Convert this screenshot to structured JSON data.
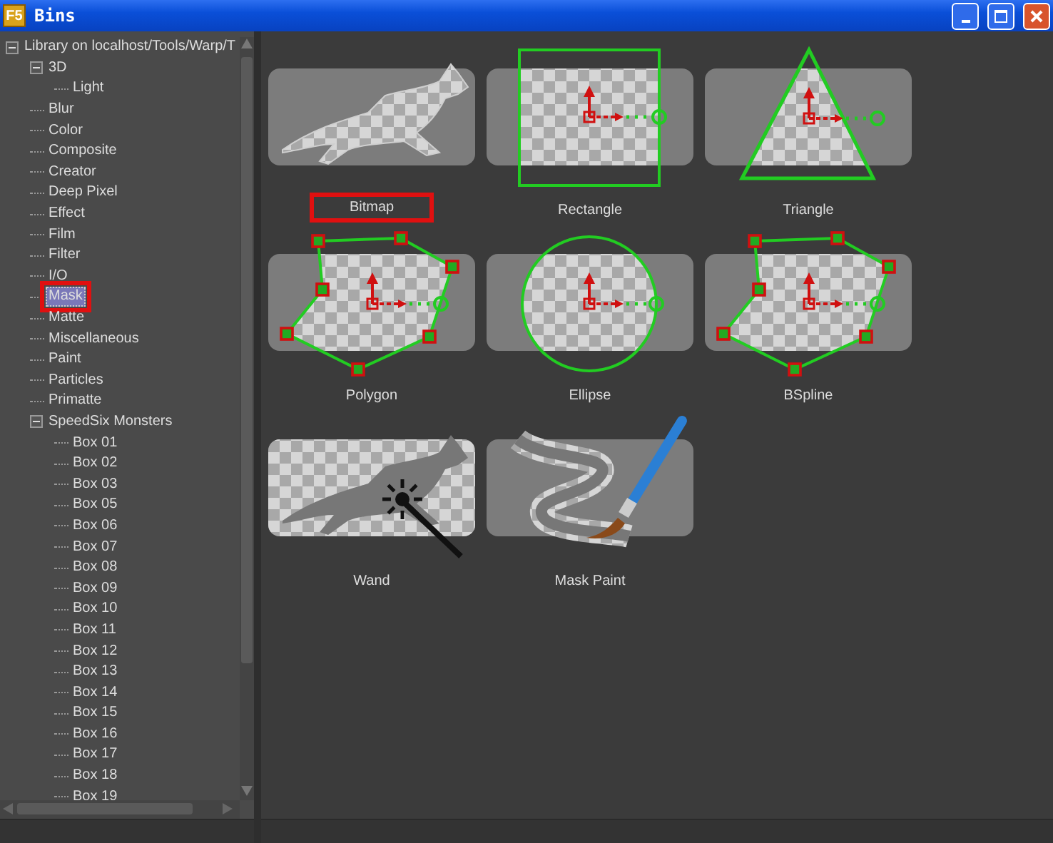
{
  "window": {
    "app_icon": "F5",
    "title": "Bins"
  },
  "tree": {
    "items": [
      {
        "label": "Library on localhost/Tools/Warp/T",
        "expanded": true,
        "selected": false,
        "highlighted": false,
        "children": [
          {
            "label": "3D",
            "expanded": true,
            "selected": false,
            "highlighted": false,
            "children": [
              {
                "label": "Light",
                "selected": false,
                "highlighted": false
              }
            ]
          },
          {
            "label": "Blur",
            "selected": false,
            "highlighted": false
          },
          {
            "label": "Color",
            "selected": false,
            "highlighted": false
          },
          {
            "label": "Composite",
            "selected": false,
            "highlighted": false
          },
          {
            "label": "Creator",
            "selected": false,
            "highlighted": false
          },
          {
            "label": "Deep Pixel",
            "selected": false,
            "highlighted": false
          },
          {
            "label": "Effect",
            "selected": false,
            "highlighted": false
          },
          {
            "label": "Film",
            "selected": false,
            "highlighted": false
          },
          {
            "label": "Filter",
            "selected": false,
            "highlighted": false
          },
          {
            "label": "I/O",
            "selected": false,
            "highlighted": false
          },
          {
            "label": "Mask",
            "selected": true,
            "highlighted": true
          },
          {
            "label": "Matte",
            "selected": false,
            "highlighted": false
          },
          {
            "label": "Miscellaneous",
            "selected": false,
            "highlighted": false
          },
          {
            "label": "Paint",
            "selected": false,
            "highlighted": false
          },
          {
            "label": "Particles",
            "selected": false,
            "highlighted": false
          },
          {
            "label": "Primatte",
            "selected": false,
            "highlighted": false
          },
          {
            "label": "SpeedSix Monsters",
            "expanded": true,
            "selected": false,
            "highlighted": false,
            "children": [
              {
                "label": "Box 01",
                "selected": false,
                "highlighted": false
              },
              {
                "label": "Box 02",
                "selected": false,
                "highlighted": false
              },
              {
                "label": "Box 03",
                "selected": false,
                "highlighted": false
              },
              {
                "label": "Box 05",
                "selected": false,
                "highlighted": false
              },
              {
                "label": "Box 06",
                "selected": false,
                "highlighted": false
              },
              {
                "label": "Box 07",
                "selected": false,
                "highlighted": false
              },
              {
                "label": "Box 08",
                "selected": false,
                "highlighted": false
              },
              {
                "label": "Box 09",
                "selected": false,
                "highlighted": false
              },
              {
                "label": "Box 10",
                "selected": false,
                "highlighted": false
              },
              {
                "label": "Box 11",
                "selected": false,
                "highlighted": false
              },
              {
                "label": "Box 12",
                "selected": false,
                "highlighted": false
              },
              {
                "label": "Box 13",
                "selected": false,
                "highlighted": false
              },
              {
                "label": "Box 14",
                "selected": false,
                "highlighted": false
              },
              {
                "label": "Box 15",
                "selected": false,
                "highlighted": false
              },
              {
                "label": "Box 16",
                "selected": false,
                "highlighted": false
              },
              {
                "label": "Box 17",
                "selected": false,
                "highlighted": false
              },
              {
                "label": "Box 18",
                "selected": false,
                "highlighted": false
              },
              {
                "label": "Box 19",
                "selected": false,
                "highlighted": false
              }
            ]
          }
        ]
      }
    ]
  },
  "tiles": [
    {
      "kind": "bitmap",
      "label": "Bitmap",
      "highlighted": true
    },
    {
      "kind": "rectangle",
      "label": "Rectangle",
      "highlighted": false
    },
    {
      "kind": "triangle",
      "label": "Triangle",
      "highlighted": false
    },
    {
      "kind": "polygon",
      "label": "Polygon",
      "highlighted": false
    },
    {
      "kind": "ellipse",
      "label": "Ellipse",
      "highlighted": false
    },
    {
      "kind": "bspline",
      "label": "BSpline",
      "highlighted": false
    },
    {
      "kind": "wand",
      "label": "Wand",
      "highlighted": false
    },
    {
      "kind": "paint",
      "label": "Mask Paint",
      "highlighted": false
    }
  ]
}
